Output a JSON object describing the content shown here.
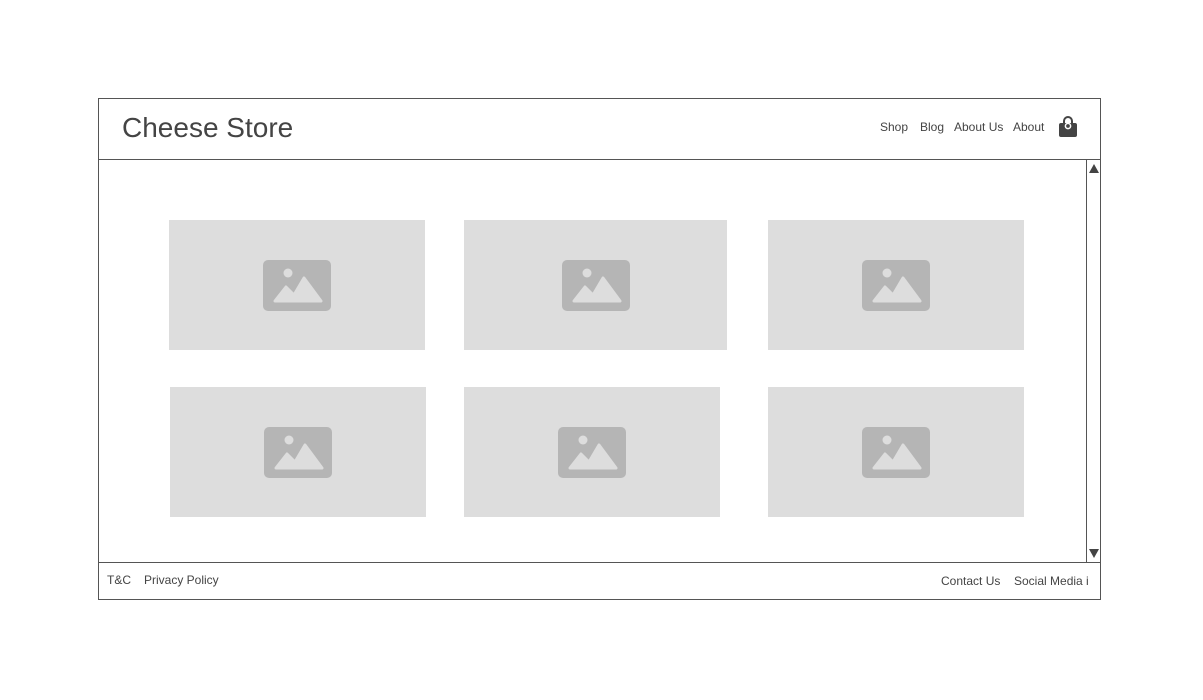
{
  "header": {
    "brand": "Cheese Store",
    "nav": [
      "Shop",
      "Blog",
      "About Us",
      "About"
    ],
    "cart_icon": "shopping-bag-icon"
  },
  "main": {
    "tiles": [
      {
        "icon": "image-placeholder-icon"
      },
      {
        "icon": "image-placeholder-icon"
      },
      {
        "icon": "image-placeholder-icon"
      },
      {
        "icon": "image-placeholder-icon"
      },
      {
        "icon": "image-placeholder-icon"
      },
      {
        "icon": "image-placeholder-icon"
      }
    ]
  },
  "scrollbar": {
    "up_icon": "triangle-up-icon",
    "down_icon": "triangle-down-icon"
  },
  "footer": {
    "links_left": [
      "T&C",
      "Privacy Policy"
    ],
    "links_right": [
      "Contact Us",
      "Social Media i"
    ]
  },
  "colors": {
    "border": "#555555",
    "placeholder_bg": "#dddddd",
    "placeholder_icon": "#b5b5b5",
    "text": "#444444"
  }
}
